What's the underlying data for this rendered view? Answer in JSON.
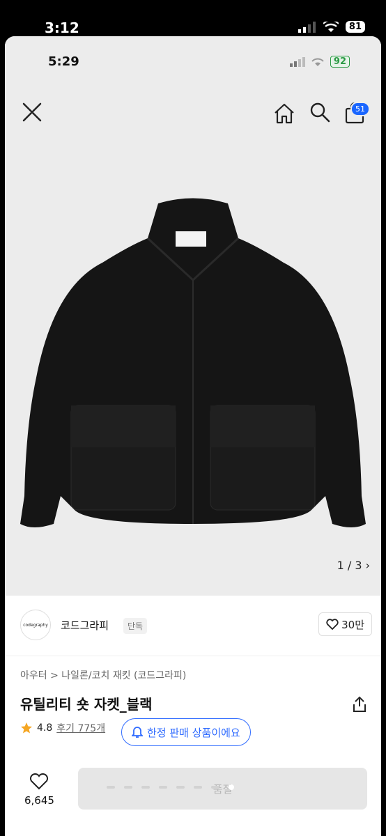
{
  "outer_status": {
    "time": "3:12",
    "battery": "81"
  },
  "inner_status": {
    "time": "5:29",
    "battery": "92"
  },
  "cart_badge": "51",
  "image_counter": "1 / 3",
  "brand": {
    "logo_text": "codegraphy",
    "name": "코드그라피",
    "tag": "단독",
    "likes": "30만"
  },
  "breadcrumb": "아우터 > 나일론/코치 재킷 (코드그라피)",
  "product_title": "유틸리티 숏 자켓_블랙",
  "rating": "4.8",
  "review_label": "후기 775개",
  "limited_label": "한정 판매 상품이에요",
  "wishlist_count": "6,645",
  "soldout_label": "품절",
  "colors": {
    "accent": "#2f6bff",
    "badge": "#1a66ff",
    "star": "#f5a623"
  }
}
